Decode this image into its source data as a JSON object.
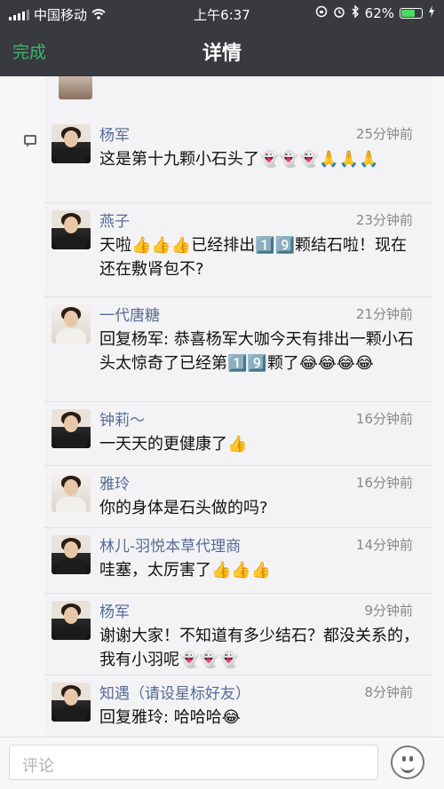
{
  "status_bar": {
    "carrier": "中国移动",
    "time": "上午6:37",
    "battery": "62%"
  },
  "nav": {
    "done_label": "完成",
    "title": "详情"
  },
  "comments": [
    {
      "name": "杨军",
      "time": "25分钟前",
      "text": "这是第十九颗小石头了👻👻👻🙏🙏🙏",
      "avatar_style": "dark"
    },
    {
      "name": "燕子",
      "time": "23分钟前",
      "text": "天啦👍👍👍已经排出1️⃣9️⃣颗结石啦！现在还在敷肾包不?",
      "avatar_style": "dark"
    },
    {
      "name": "一代唐糖",
      "time": "21分钟前",
      "text": "回复杨军: 恭喜杨军大咖今天有排出一颗小石头太惊奇了已经第1️⃣9️⃣颗了😂😂😂😂",
      "avatar_style": "light"
    },
    {
      "name": "钟莉～",
      "time": "16分钟前",
      "text": "一天天的更健康了👍",
      "avatar_style": "dark"
    },
    {
      "name": "雅玲",
      "time": "16分钟前",
      "text": "你的身体是石头做的吗?",
      "avatar_style": "light"
    },
    {
      "name": "林儿-羽悦本草代理商",
      "time": "14分钟前",
      "text": "哇塞，太厉害了👍👍👍",
      "avatar_style": "dark"
    },
    {
      "name": "杨军",
      "time": "9分钟前",
      "text": "谢谢大家！不知道有多少结石？都没关系的，我有小羽呢👻👻👻",
      "avatar_style": "dark"
    },
    {
      "name": "知遇（请设星标好友）",
      "time": "8分钟前",
      "text": "回复雅玲: 哈哈哈😂",
      "avatar_style": "dark"
    }
  ],
  "composer": {
    "placeholder": "评论"
  },
  "icons": {
    "comment": "comment-icon",
    "emoji": "emoji-icon",
    "wifi": "wifi-icon",
    "battery": "battery-icon"
  },
  "colors": {
    "bar": "#393a3f",
    "done": "#3cb371",
    "name": "#576b95"
  }
}
